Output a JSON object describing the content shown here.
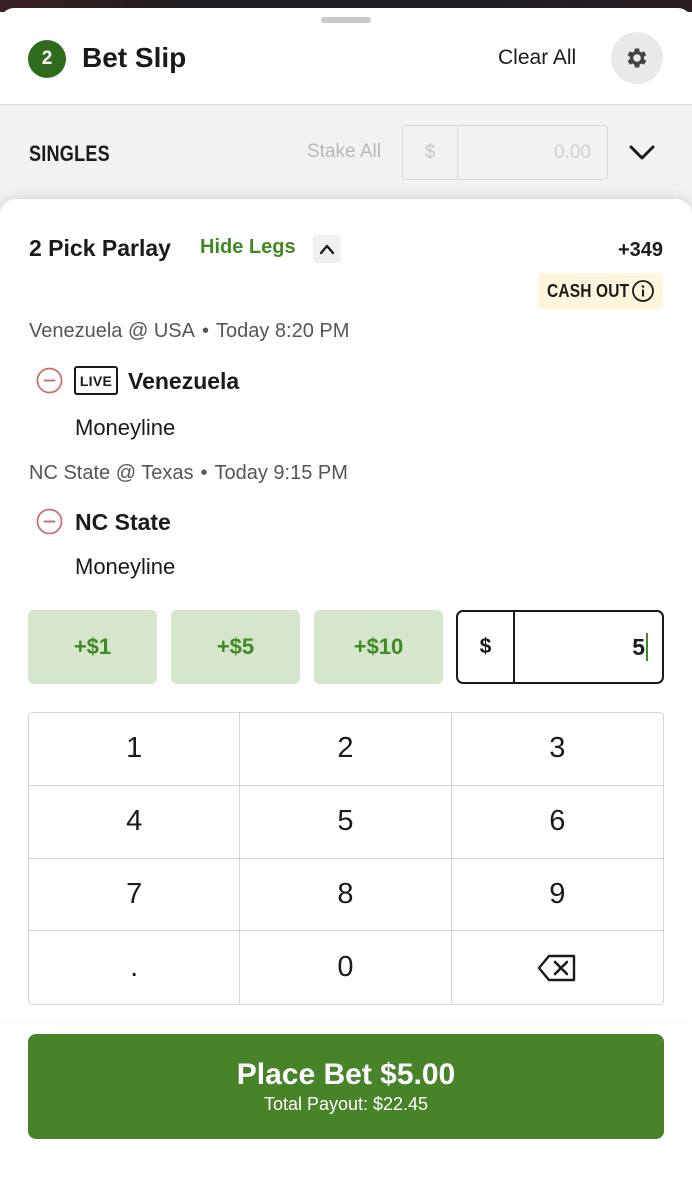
{
  "header": {
    "count": "2",
    "title": "Bet Slip",
    "clear_all": "Clear All",
    "settings_icon": "gear-icon"
  },
  "singles": {
    "label": "SINGLES",
    "stake_all": "Stake All",
    "currency": "$",
    "placeholder": "0.00",
    "expand_icon": "chevron-down-icon"
  },
  "parlay": {
    "title": "2 Pick Parlay",
    "hide_legs": "Hide Legs",
    "odds": "+349",
    "cash_out": "CASH OUT",
    "legs": [
      {
        "event": "Venezuela @ USA",
        "time": "Today 8:20 PM",
        "live": "LIVE",
        "team": "Venezuela",
        "market": "Moneyline"
      },
      {
        "event": "NC State @ Texas",
        "time": "Today 9:15 PM",
        "team": "NC State",
        "market": "Moneyline"
      }
    ]
  },
  "quick_amounts": [
    "+$1",
    "+$5",
    "+$10"
  ],
  "stake": {
    "currency": "$",
    "value": "5"
  },
  "keypad": [
    "1",
    "2",
    "3",
    "4",
    "5",
    "6",
    "7",
    "8",
    "9",
    ".",
    "0"
  ],
  "place_bet": {
    "label": "Place Bet $5.00",
    "payout": "Total Payout: $22.45"
  },
  "colors": {
    "brand_green": "#478328",
    "accent_green": "#3f8a23",
    "quick_bg": "#d5e6cc",
    "cashout_bg": "#fdf6dd",
    "remove_red": "#d46a6a"
  }
}
